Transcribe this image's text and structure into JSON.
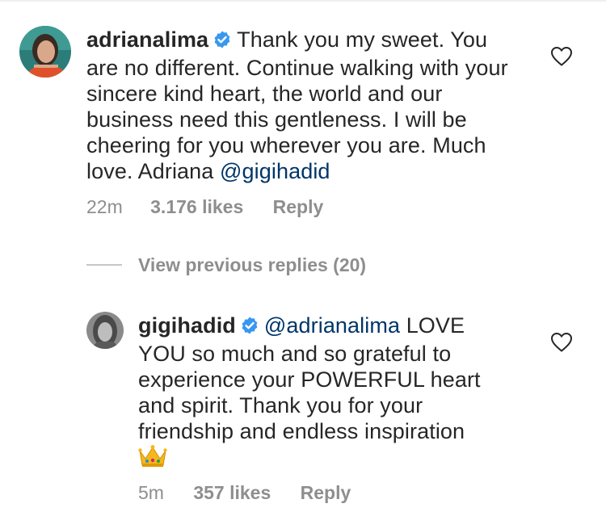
{
  "comments": [
    {
      "username": "adrianalima",
      "body": "Thank you my sweet. You are no different. Continue walking with your sincere kind heart, the world and our business need this gentleness. I will be cheering for you wherever you are. Much love. Adriana",
      "mention": "@gigihadid",
      "time": "22m",
      "likes": "3.176 likes",
      "reply_label": "Reply"
    }
  ],
  "view_previous_replies": "View previous replies (20)",
  "reply": {
    "username": "gigihadid",
    "mention": "@adrianalima",
    "body": "LOVE YOU so much and so grateful to experience your POWERFUL heart and spirit. Thank you for your friendship and endless inspiration",
    "emoji": "crown",
    "time": "5m",
    "likes": "357 likes",
    "reply_label": "Reply"
  },
  "icons": {
    "verified": "verified-badge-icon",
    "like": "heart-outline-icon"
  },
  "colors": {
    "verified_blue": "#3897f0",
    "mention": "#003569",
    "meta_gray": "#8e8e8e",
    "text": "#262626"
  }
}
